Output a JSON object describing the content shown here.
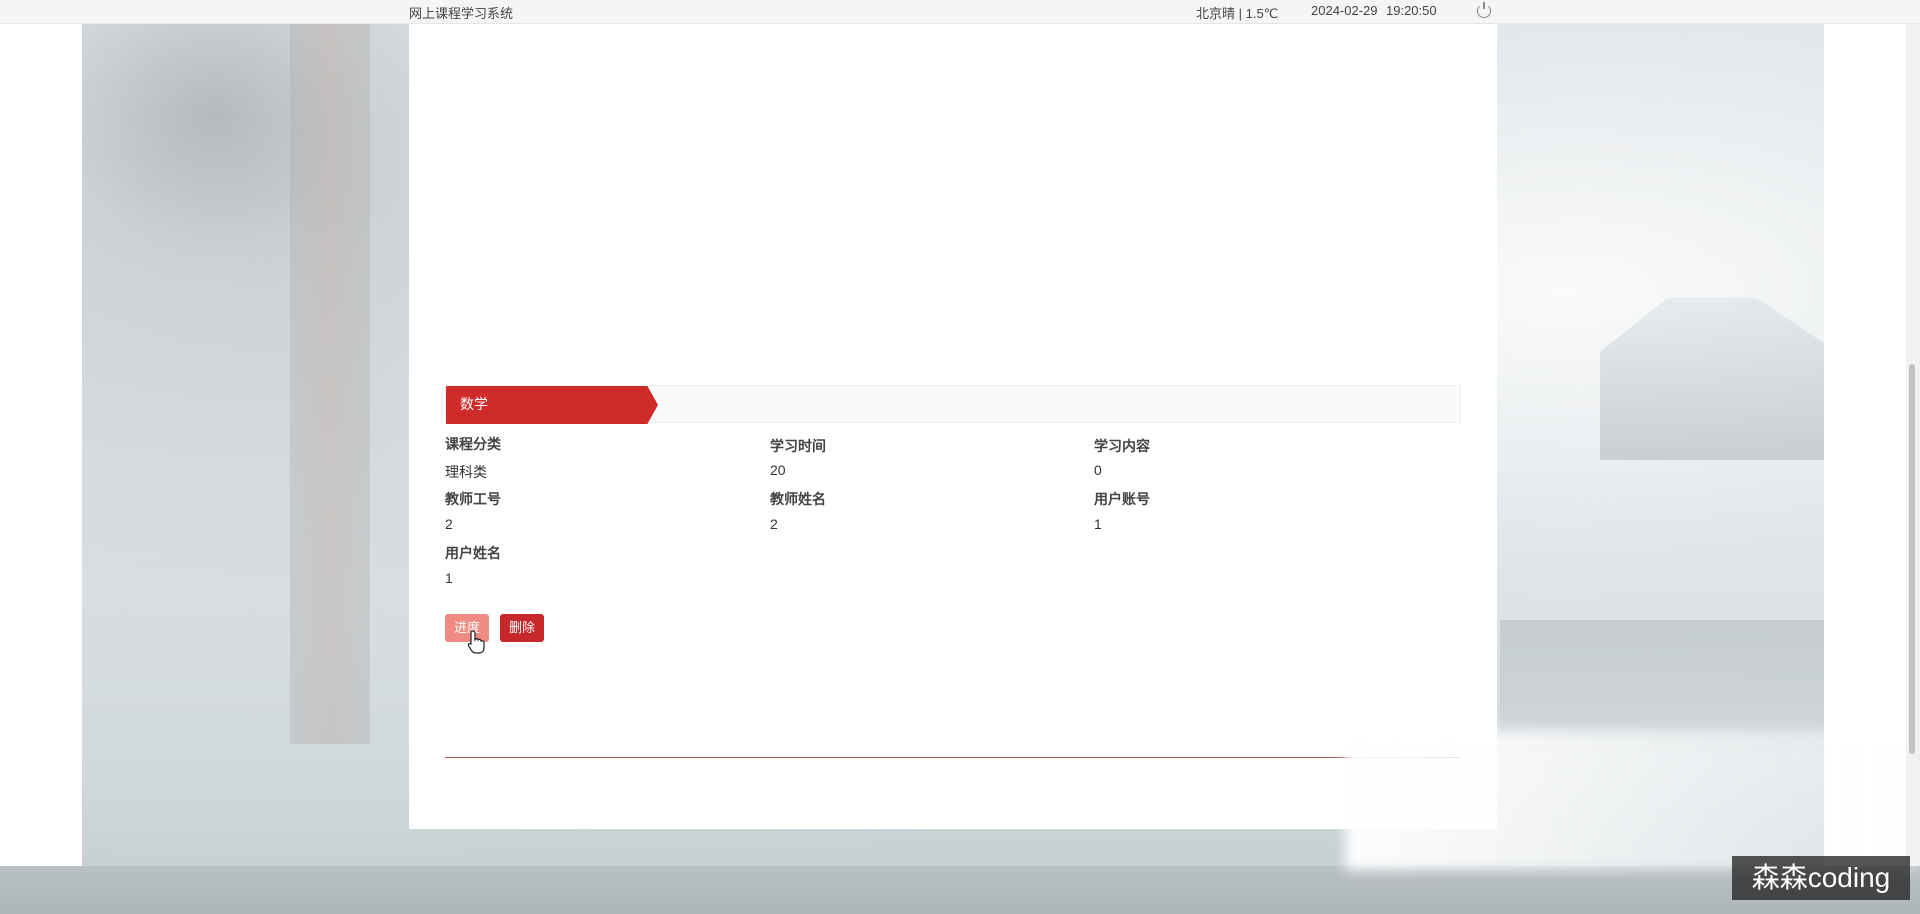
{
  "topbar": {
    "app_title": "网上课程学习系统",
    "weather": "北京晴 | 1.5℃",
    "date": "2024-02-29",
    "time": "19:20:50",
    "power_icon": "power-icon"
  },
  "course": {
    "name": "数学",
    "fields": [
      {
        "label": "课程分类",
        "value": "理科类"
      },
      {
        "label": "学习时间",
        "value": "20"
      },
      {
        "label": "学习内容",
        "value": "0"
      },
      {
        "label": "教师工号",
        "value": "2"
      },
      {
        "label": "教师姓名",
        "value": "2"
      },
      {
        "label": "用户账号",
        "value": "1"
      },
      {
        "label": "用户姓名",
        "value": "1"
      }
    ]
  },
  "actions": {
    "progress_label": "进度",
    "delete_label": "删除"
  },
  "watermark": "森森coding",
  "colors": {
    "accent": "#cf2b2b",
    "progress_button": "#f08b84",
    "delete_button": "#c8282c",
    "divider": "#a85757"
  }
}
